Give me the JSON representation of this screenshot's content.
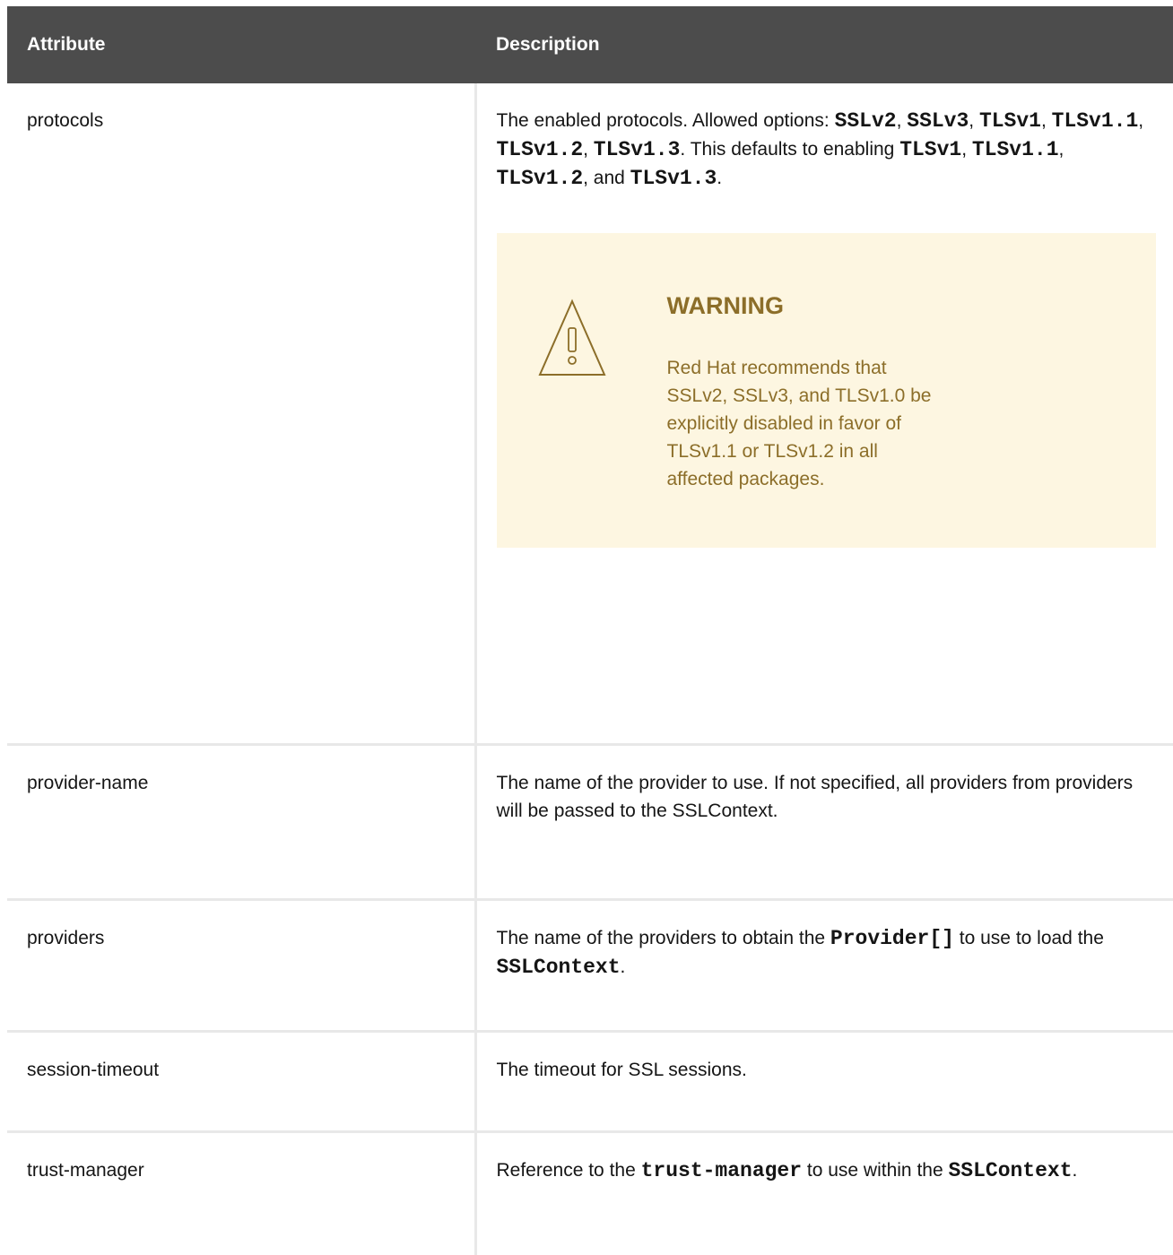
{
  "table": {
    "headers": {
      "attribute": "Attribute",
      "description": "Description"
    },
    "rows": {
      "protocols": {
        "attribute": "protocols",
        "desc": {
          "t1": "The enabled protocols. Allowed options: ",
          "c1": "SSLv2",
          "t2": ", ",
          "c2": "SSLv3",
          "t3": ", ",
          "c3": "TLSv1",
          "t4": ", ",
          "c4": "TLSv1.1",
          "t5": ", ",
          "c5": "TLSv1.2",
          "t6": ", ",
          "c6": "TLSv1.3",
          "t7": ". This defaults to enabling ",
          "c7": "TLSv1",
          "t8": ", ",
          "c8": "TLSv1.1",
          "t9": ", ",
          "c9": "TLSv1.2",
          "t10": ", and ",
          "c10": "TLSv1.3",
          "t11": "."
        },
        "warning": {
          "icon": "warning-triangle-icon",
          "title": "WARNING",
          "text": "Red Hat recommends that SSLv2, SSLv3, and TLSv1.0 be explicitly disabled in favor of TLSv1.1 or TLSv1.2 in all affected packages."
        }
      },
      "provider_name": {
        "attribute": "provider-name",
        "description": "The name of the provider to use. If not specified, all providers from providers will be passed to the SSLContext."
      },
      "providers": {
        "attribute": "providers",
        "desc": {
          "t1": "The name of the providers to obtain the ",
          "c1": "Provider[]",
          "t2": " to use to load the ",
          "c2": "SSLContext",
          "t3": "."
        }
      },
      "session_timeout": {
        "attribute": "session-timeout",
        "description": "The timeout for SSL sessions."
      },
      "trust_manager": {
        "attribute": "trust-manager",
        "desc": {
          "t1": "Reference to the ",
          "c1": "trust-manager",
          "t2": " to use within the ",
          "c2": "SSLContext",
          "t3": "."
        }
      }
    }
  },
  "colors": {
    "header_bg": "#4c4c4c",
    "header_text": "#ffffff",
    "border": "#e8e8e8",
    "warning_bg": "#fdf6e1",
    "warning_text": "#8c6e29"
  }
}
